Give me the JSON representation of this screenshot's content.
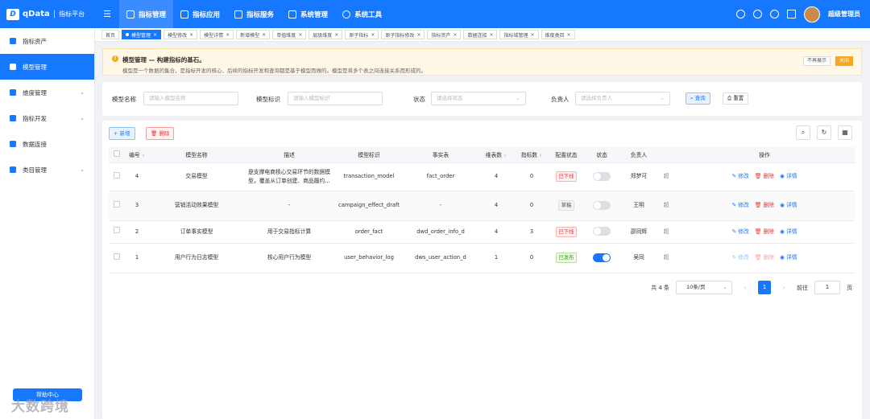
{
  "app": {
    "logo": "qData",
    "subtitle": "指标平台",
    "user": "超级管理员"
  },
  "topnav": [
    {
      "label": "指标管理",
      "active": true
    },
    {
      "label": "指标应用"
    },
    {
      "label": "指标服务"
    },
    {
      "label": "系统管理"
    },
    {
      "label": "系统工具"
    }
  ],
  "sidebar": {
    "items": [
      {
        "label": "指标资产",
        "icon": "asset-icon"
      },
      {
        "label": "模型管理",
        "icon": "model-icon",
        "active": true
      },
      {
        "label": "维度管理",
        "icon": "dimension-icon",
        "expandable": true
      },
      {
        "label": "指标开发",
        "icon": "develop-icon",
        "expandable": true
      },
      {
        "label": "数据连接",
        "icon": "connection-icon"
      },
      {
        "label": "类目管理",
        "icon": "category-icon",
        "expandable": true
      }
    ],
    "help": "帮助中心",
    "watermark": "大数跨境"
  },
  "tabs": [
    "首页",
    "模型管理",
    "模型修改",
    "模型详情",
    "新增模型",
    "单值维度",
    "层级维度",
    "原子指标",
    "原子指标修改",
    "指标资产",
    "数据连接",
    "指标域管理",
    "维度类目"
  ],
  "notice": {
    "title": "模型管理 — 构建指标的基石。",
    "text": "模型是一个数据的集合，是指标开发的核心、后续的指标开发和查询都是基于模型而做的。模型是将多个表之间连接关系而形成的。",
    "hide": "不再展示",
    "close": "关闭"
  },
  "filters": {
    "name_label": "模型名称",
    "name_placeholder": "请输入模型名称",
    "id_label": "模型标识",
    "id_placeholder": "请输入模型标识",
    "status_label": "状态",
    "status_placeholder": "请选择状态",
    "owner_label": "负责人",
    "owner_placeholder": "请选择负责人",
    "search": "查询",
    "reset": "重置"
  },
  "toolbar": {
    "add": "+ 新增",
    "delete": "删除"
  },
  "columns": [
    "编号",
    "模型名称",
    "描述",
    "模型标识",
    "事实表",
    "维表数",
    "指标数",
    "配置状态",
    "状态",
    "负责人",
    "操作"
  ],
  "rows": [
    {
      "id": "4",
      "name": "交易模型",
      "desc": "是支撑电商核心交易环节的数据模型，覆盖从订单创建、商品履约...",
      "ident": "transaction_model",
      "fact": "fact_order",
      "dims": "4",
      "metrics": "0",
      "config": "已下线",
      "config_color": "red",
      "on": false,
      "owner": "郑梦可",
      "extra": "超"
    },
    {
      "id": "3",
      "name": "营销活动效果模型",
      "desc": "-",
      "ident": "campaign_effect_draft",
      "fact": "-",
      "dims": "4",
      "metrics": "0",
      "config": "草稿",
      "config_color": "grey",
      "on": false,
      "owner": "王明",
      "extra": "超"
    },
    {
      "id": "2",
      "name": "订单事实模型",
      "desc": "用于交易指标计算",
      "ident": "order_fact",
      "fact": "dwd_order_info_d",
      "dims": "4",
      "metrics": "3",
      "config": "已下线",
      "config_color": "red",
      "on": false,
      "owner": "邵同辉",
      "extra": "超"
    },
    {
      "id": "1",
      "name": "用户行为日志模型",
      "desc": "核心用户行为模型",
      "ident": "user_behavior_log",
      "fact": "dws_user_action_d",
      "dims": "1",
      "metrics": "0",
      "config": "已发布",
      "config_color": "green",
      "on": true,
      "owner": "吴同",
      "extra": "超",
      "edit_disabled": true
    }
  ],
  "actions": {
    "edit": "修改",
    "remove": "删除",
    "detail": "详情"
  },
  "pager": {
    "total": "共 4 条",
    "size": "10条/页",
    "page": "1",
    "jump": "前往",
    "jump_val": "1",
    "unit": "页"
  },
  "colors": {
    "primary": "#1677ff",
    "warning": "#f5a623",
    "danger": "#e03535",
    "success": "#389e0d"
  }
}
